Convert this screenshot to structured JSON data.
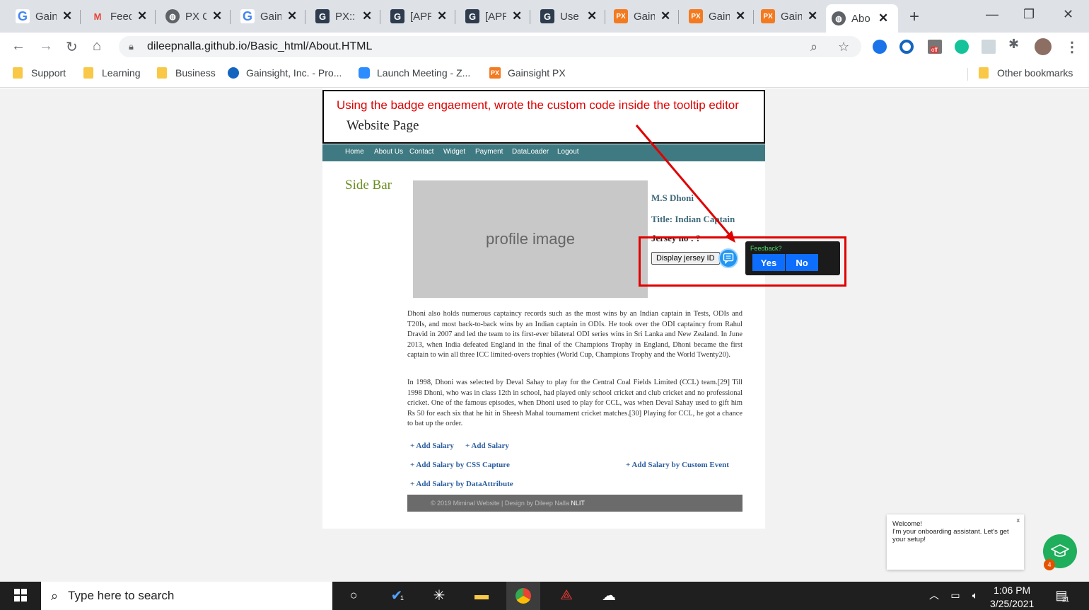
{
  "browser": {
    "tabs": [
      {
        "title": "Gain",
        "icon": "google-icon"
      },
      {
        "title": "Feed",
        "icon": "gmail-icon"
      },
      {
        "title": "PX C",
        "icon": "globe-icon"
      },
      {
        "title": "Gain",
        "icon": "google-icon"
      },
      {
        "title": "PX::",
        "icon": "gainsight-icon"
      },
      {
        "title": "[APF",
        "icon": "gainsight-icon"
      },
      {
        "title": "[APF",
        "icon": "gainsight-icon"
      },
      {
        "title": "Use",
        "icon": "gainsight-icon"
      },
      {
        "title": "Gain",
        "icon": "px-icon"
      },
      {
        "title": "Gain",
        "icon": "px-icon"
      },
      {
        "title": "Gain",
        "icon": "px-icon"
      },
      {
        "title": "Abo",
        "icon": "globe-icon"
      }
    ],
    "url": "dileepnalla.github.io/Basic_html/About.HTML",
    "bookmarks": [
      "Support",
      "Learning",
      "Business",
      "Gainsight, Inc. - Pro...",
      "Launch Meeting - Z...",
      "Gainsight PX"
    ],
    "other_bookmarks": "Other bookmarks",
    "ext_badge": "off"
  },
  "page": {
    "annotation": "Using the badge engaement, wrote the custom code inside the tooltip editor",
    "site_title": "Website Page",
    "nav": [
      "Home",
      "About Us",
      "Contact",
      "Widget",
      "Payment",
      "DataLoader",
      "Logout"
    ],
    "sidebar_title": "Side Bar",
    "profile_placeholder": "profile image",
    "name": "M.S Dhoni",
    "title_line": "Title: Indian Captain",
    "jersey_line": "Jersey no : ?",
    "display_jersey_btn": "Display jersey ID",
    "tooltip": {
      "question": "Feedback?",
      "yes": "Yes",
      "no": "No"
    },
    "para1": "Dhoni also holds numerous captaincy records such as the most wins by an Indian captain in Tests, ODIs and T20Is, and most back-to-back wins by an Indian captain in ODIs. He took over the ODI captaincy from Rahul Dravid in 2007 and led the team to its first-ever bilateral ODI series wins in Sri Lanka and New Zealand. In June 2013, when India defeated England in the final of the Champions Trophy in England, Dhoni became the first captain to win all three ICC limited-overs trophies (World Cup, Champions Trophy and the World Twenty20).",
    "para2": "In 1998, Dhoni was selected by Deval Sahay to play for the Central Coal Fields Limited (CCL) team.[29] Till 1998 Dhoni, who was in class 12th in school, had played only school cricket and club cricket and no professional cricket. One of the famous episodes, when Dhoni used to play for CCL, was when Deval Sahay used to gift him Rs 50 for each six that he hit in Sheesh Mahal tournament cricket matches.[30] Playing for CCL, he got a chance to bat up the order.",
    "add_salary_1": "+ Add Salary",
    "add_salary_2": "+ Add Salary",
    "add_salary_css": "+ Add Salary by CSS Capture",
    "add_salary_event": "+ Add Salary by Custom Event",
    "add_salary_data": "+ Add Salary by DataAttribute",
    "footer_text": "© 2019 Miminal Website | Design by Dileep Nalla",
    "footer_link": "NLIT"
  },
  "widget": {
    "welcome_line1": "Welcome!",
    "welcome_line2": "I'm your onboarding assistant. Let's get your setup!",
    "close": "x",
    "count": "4"
  },
  "taskbar": {
    "search_placeholder": "Type here to search",
    "time": "1:06 PM",
    "date": "3/25/2021",
    "todo_badge": "1",
    "notif_badge": "21"
  },
  "colors": {
    "accent_red": "#e00000",
    "nav_teal": "#3f7a82",
    "badge_blue": "#2196f3",
    "help_green": "#1fae5b"
  }
}
